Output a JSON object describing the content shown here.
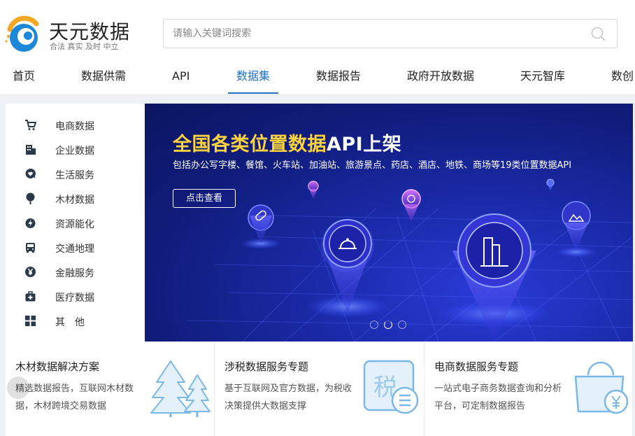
{
  "header": {
    "logo_name": "天元数据",
    "logo_slogan": "合法 真实 及时 中立",
    "search_placeholder": "请输入关键词搜索"
  },
  "nav": {
    "items": [
      "首页",
      "数据供需",
      "API",
      "数据集",
      "数据报告",
      "政府开放数据",
      "天元智库",
      "数创"
    ],
    "active_index": 3
  },
  "sidebar": {
    "items": [
      {
        "label": "电商数据",
        "icon": "cart-icon"
      },
      {
        "label": "企业数据",
        "icon": "building-icon"
      },
      {
        "label": "生活服务",
        "icon": "heart-chat-icon"
      },
      {
        "label": "木材数据",
        "icon": "tree-icon"
      },
      {
        "label": "资源能化",
        "icon": "flame-icon"
      },
      {
        "label": "交通地理",
        "icon": "bus-icon"
      },
      {
        "label": "金融服务",
        "icon": "yen-icon"
      },
      {
        "label": "医疗数据",
        "icon": "medical-kit-icon"
      },
      {
        "label": "其　他",
        "icon": "grid-icon"
      }
    ]
  },
  "banner": {
    "title_highlight": "全国各类位置数据",
    "title_rest": "API上架",
    "subtitle": "包括办公写字楼、餐馆、火车站、加油站、旅游景点、药店、酒店、地铁、商场等19类位置数据API",
    "button_label": "点击查看",
    "slide_count": 3,
    "active_slide": 1
  },
  "cards": [
    {
      "title": "木材数据解决方案",
      "desc": "精选数据报告，互联网木材数据，木材跨境交易数据",
      "icon": "trees-icon"
    },
    {
      "title": "涉税数据服务专题",
      "desc": "基于互联网及官方数据，为税收决策提供大数据支撑",
      "icon": "tax-icon",
      "icon_text": "税"
    },
    {
      "title": "电商数据服务专题",
      "desc": "一站式电子商务数据查询和分析平台，可定制数据报告",
      "icon": "shopping-bag-icon"
    }
  ],
  "colors": {
    "accent": "#1f6fc4",
    "banner_highlight": "#ffd33d",
    "banner_bg": "#1a2aa8",
    "logo_orange": "#f5a623",
    "logo_blue": "#1e88d8"
  }
}
